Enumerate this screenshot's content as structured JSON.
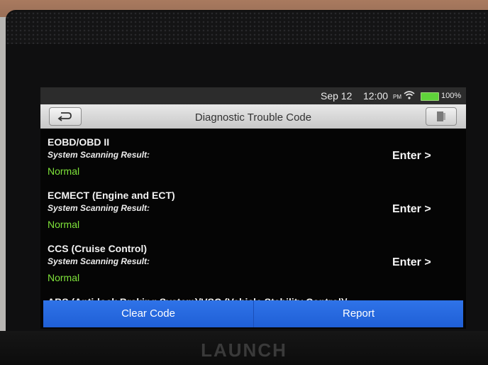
{
  "status_bar": {
    "date": "Sep 12",
    "time": "12:00",
    "ampm": "PM",
    "battery": "100%",
    "battery_color": "#5fd33a"
  },
  "header": {
    "title": "Diagnostic Trouble Code",
    "back_icon": "back-arrow-icon",
    "exit_icon": "exit-door-icon"
  },
  "systems": [
    {
      "name": "EOBD/OBD II",
      "scan_label": "System Scanning Result:",
      "status": "Normal",
      "action": "Enter >"
    },
    {
      "name": "ECMECT (Engine and ECT)",
      "scan_label": "System Scanning Result:",
      "status": "Normal",
      "action": "Enter >"
    },
    {
      "name": "CCS (Cruise Control)",
      "scan_label": "System Scanning Result:",
      "status": "Normal",
      "action": "Enter >"
    },
    {
      "name": "ABS (Anti-lock Braking System)/VSC (Vehicle Stability Control)/"
    }
  ],
  "footer": {
    "clear_code": "Clear Code",
    "report": "Report",
    "accent_color": "#2f73e8"
  },
  "device": {
    "brand": "LAUNCH"
  },
  "colors": {
    "status_normal": "#7ee23a"
  }
}
